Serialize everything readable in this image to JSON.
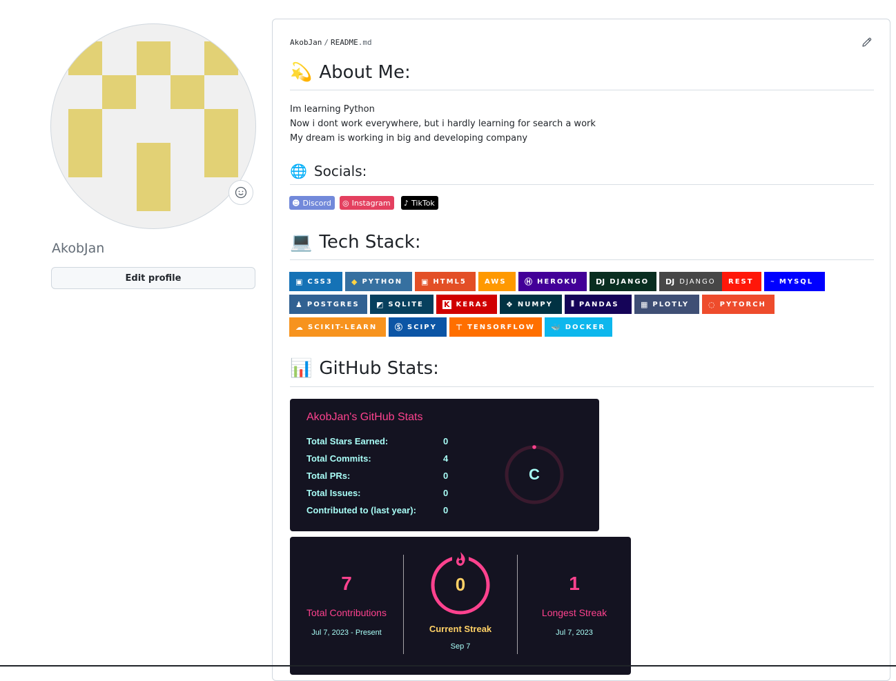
{
  "profile": {
    "username": "AkobJan",
    "edit_label": "Edit profile",
    "avatar_color": "#e2d175"
  },
  "readme": {
    "path_user": "AkobJan",
    "path_file": "README",
    "path_ext": ".md",
    "about": {
      "emoji": "💫",
      "title": "About Me:",
      "lines": [
        "Im learning Python",
        "Now i dont work everywhere, but i hardly learning for search a work",
        "My dream is working in big and developing company"
      ]
    },
    "socials": {
      "emoji": "🌐",
      "title": "Socials:",
      "badges": [
        {
          "label": "Discord",
          "icon": "discord-icon",
          "color": "#7289da"
        },
        {
          "label": "Instagram",
          "icon": "instagram-icon",
          "color": "#e4405f"
        },
        {
          "label": "TikTok",
          "icon": "tiktok-icon",
          "color": "#000000"
        }
      ]
    },
    "tech": {
      "emoji": "💻",
      "title": "Tech Stack:",
      "badges": [
        {
          "label": "css3",
          "color": "#1572b6"
        },
        {
          "label": "python",
          "color": "#3670a0"
        },
        {
          "label": "html5",
          "color": "#e34f26"
        },
        {
          "label": "AWS",
          "color": "#ff9900"
        },
        {
          "label": "heroku",
          "color": "#430098"
        },
        {
          "label": "Django",
          "color": "#092e20"
        },
        {
          "label": "DJANGO",
          "color": "#474747"
        },
        {
          "label": "REST",
          "color": "#ff1709"
        },
        {
          "label": "MySQL",
          "color": "#00f"
        },
        {
          "label": "Postgres",
          "color": "#316192"
        },
        {
          "label": "SQLite",
          "color": "#07405e"
        },
        {
          "label": "Keras",
          "color": "#d00000"
        },
        {
          "label": "NumPy",
          "color": "#013243"
        },
        {
          "label": "Pandas",
          "color": "#150458"
        },
        {
          "label": "Plotly",
          "color": "#3f4f75"
        },
        {
          "label": "PyTorch",
          "color": "#ee4c2c"
        },
        {
          "label": "scikit-learn",
          "color": "#f7931e"
        },
        {
          "label": "SciPy",
          "color": "#0c55a5"
        },
        {
          "label": "TensorFlow",
          "color": "#ff6f00"
        },
        {
          "label": "docker",
          "color": "#0db7ed"
        }
      ]
    },
    "stats": {
      "emoji": "📊",
      "title": "GitHub Stats:",
      "card_title": "AkobJan's GitHub Stats",
      "rows": [
        {
          "label": "Total Stars Earned:",
          "value": "0"
        },
        {
          "label": "Total Commits:",
          "value": "4"
        },
        {
          "label": "Total PRs:",
          "value": "0"
        },
        {
          "label": "Total Issues:",
          "value": "0"
        },
        {
          "label": "Contributed to (last year):",
          "value": "0"
        }
      ],
      "rank": "C",
      "streak": {
        "total": {
          "value": "7",
          "label": "Total Contributions",
          "range": "Jul 7, 2023 - Present"
        },
        "current": {
          "value": "0",
          "label": "Current Streak",
          "range": "Sep 7"
        },
        "longest": {
          "value": "1",
          "label": "Longest Streak",
          "range": "Jul 7, 2023"
        }
      }
    }
  }
}
